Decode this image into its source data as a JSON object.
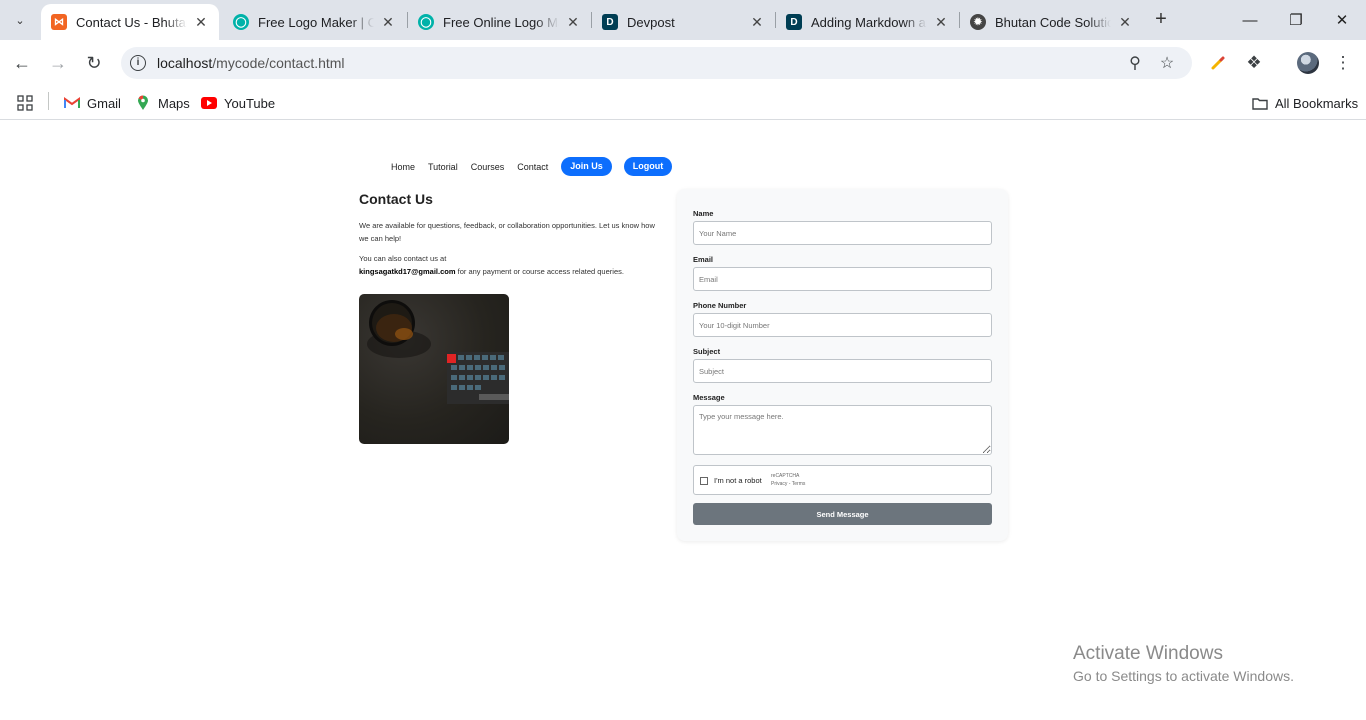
{
  "browser": {
    "tabs": [
      {
        "title": "Contact Us - Bhutan Code Solutions",
        "active": true,
        "favicon": "xampp-icon",
        "favicon_color": "#f26522"
      },
      {
        "title": "Free Logo Maker | Create a Logo",
        "active": false,
        "favicon": "logo-maker-icon",
        "favicon_color": "#00b2a9"
      },
      {
        "title": "Free Online Logo Maker",
        "active": false,
        "favicon": "logo-maker-icon",
        "favicon_color": "#00b2a9"
      },
      {
        "title": "Devpost",
        "active": false,
        "favicon": "devpost-icon",
        "favicon_color": "#003e54"
      },
      {
        "title": "Adding Markdown and",
        "active": false,
        "favicon": "devpost-icon",
        "favicon_color": "#003e54"
      },
      {
        "title": "Bhutan Code Solutions",
        "active": false,
        "favicon": "openai-icon",
        "favicon_color": "#444444"
      }
    ],
    "url_host": "localhost",
    "url_path": "/mycode/contact.html",
    "bookmarks": [
      {
        "label": "Gmail",
        "icon": "gmail-icon"
      },
      {
        "label": "Maps",
        "icon": "maps-icon"
      },
      {
        "label": "YouTube",
        "icon": "youtube-icon"
      }
    ],
    "all_bookmarks_label": "All Bookmarks"
  },
  "site_nav": {
    "links": [
      "Home",
      "Tutorial",
      "Courses",
      "Contact"
    ],
    "join_label": "Join Us",
    "logout_label": "Logout",
    "accent_color": "#0d6efd"
  },
  "contact": {
    "title": "Contact Us",
    "intro": "We are available for questions, feedback, or collaboration opportunities. Let us know how we can help!",
    "also_prefix": "You can also contact us at",
    "email": "kingsagatkd17@gmail.com",
    "also_suffix": "for any payment or course access related queries."
  },
  "form": {
    "fields": [
      {
        "label": "Name",
        "placeholder": "Your Name",
        "value": ""
      },
      {
        "label": "Email",
        "placeholder": "Email",
        "value": ""
      },
      {
        "label": "Phone Number",
        "placeholder": "Your 10-digit Number",
        "value": ""
      },
      {
        "label": "Subject",
        "placeholder": "Subject",
        "value": ""
      }
    ],
    "message_label": "Message",
    "message_placeholder": "Type your message here.",
    "captcha_label": "I'm not a robot",
    "captcha_brand": "reCAPTCHA",
    "captcha_links": "Privacy - Terms",
    "submit_label": "Send Message",
    "submit_color": "#6c757d"
  },
  "watermark": {
    "line1": "Activate Windows",
    "line2": "Go to Settings to activate Windows."
  }
}
